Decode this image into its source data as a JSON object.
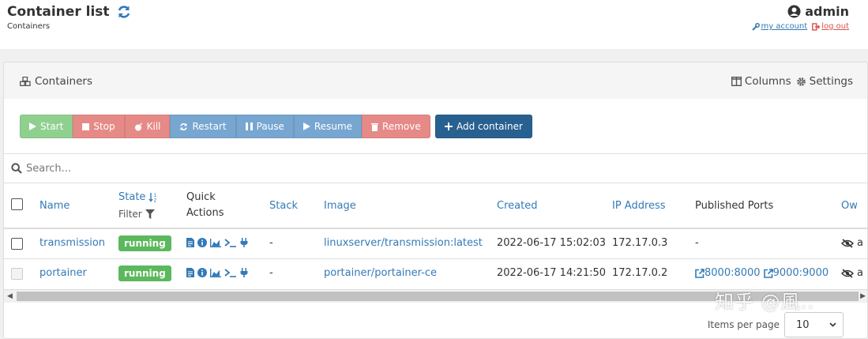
{
  "header": {
    "title": "Container list",
    "breadcrumb": "Containers",
    "user": "admin",
    "my_account": "my account",
    "log_out": "log out"
  },
  "panel": {
    "title": "Containers",
    "columns_label": "Columns",
    "settings_label": "Settings"
  },
  "actions": {
    "start": "Start",
    "stop": "Stop",
    "kill": "Kill",
    "restart": "Restart",
    "pause": "Pause",
    "resume": "Resume",
    "remove": "Remove",
    "add": "Add container"
  },
  "search": {
    "placeholder": "Search..."
  },
  "table": {
    "columns": {
      "name": "Name",
      "state": "State",
      "filter": "Filter",
      "quick_actions_1": "Quick",
      "quick_actions_2": "Actions",
      "stack": "Stack",
      "image": "Image",
      "created": "Created",
      "ip": "IP Address",
      "ports": "Published Ports",
      "ownership": "Ow"
    },
    "rows": [
      {
        "name": "transmission",
        "state": "running",
        "stack": "-",
        "image": "linuxserver/transmission:latest",
        "created": "2022-06-17 15:02:03",
        "ip": "172.17.0.3",
        "ports": [
          "-"
        ],
        "ownership": "a"
      },
      {
        "name": "portainer",
        "state": "running",
        "stack": "-",
        "image": "portainer/portainer-ce",
        "created": "2022-06-17 14:21:50",
        "ip": "172.17.0.2",
        "ports": [
          "8000:8000",
          "9000:9000"
        ],
        "ownership": "a"
      }
    ]
  },
  "pager": {
    "label": "Items per page",
    "value": "10"
  },
  "watermark": "知乎 @風..",
  "colors": {
    "link": "#337ab7",
    "running": "#5cb85c",
    "primary": "#286090",
    "danger": "#e68a87",
    "success": "#8fd08f",
    "info": "#77a6d1"
  }
}
